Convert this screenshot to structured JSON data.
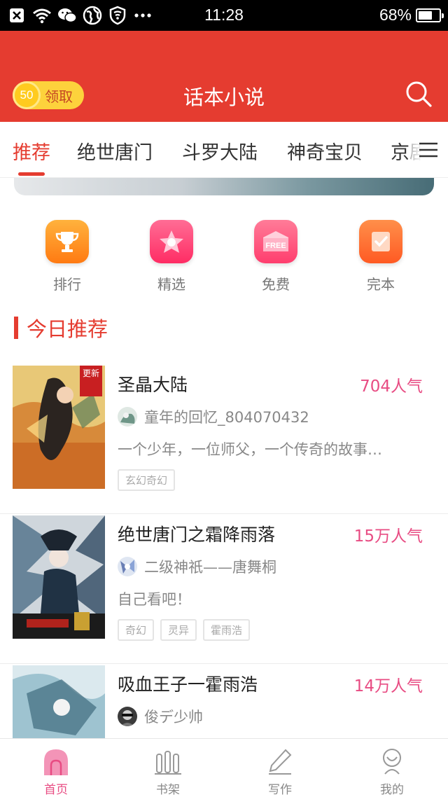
{
  "status_bar": {
    "time": "11:28",
    "battery": "68%",
    "battery_level": 0.68,
    "icons": [
      "close-box-icon",
      "wifi-icon",
      "wechat-icon",
      "globe-icon",
      "shield-icon",
      "more-dots-icon"
    ]
  },
  "header": {
    "coin_amount": "50",
    "claim_label": "领取",
    "title": "话本小说",
    "search_icon": "search-icon"
  },
  "tabs": [
    {
      "label": "推荐",
      "active": true
    },
    {
      "label": "绝世唐门",
      "active": false
    },
    {
      "label": "斗罗大陆",
      "active": false
    },
    {
      "label": "神奇宝贝",
      "active": false
    },
    {
      "label": "京剧",
      "active": false
    }
  ],
  "quick_entries": [
    {
      "label": "排行",
      "icon": "trophy-icon",
      "color": "#ff8a1d"
    },
    {
      "label": "精选",
      "icon": "star-icon",
      "color": "#ff3f77"
    },
    {
      "label": "免费",
      "icon": "free-icon",
      "color": "#ff4f76",
      "icon_text": "FREE"
    },
    {
      "label": "完本",
      "icon": "check-note-icon",
      "color": "#ff6633"
    }
  ],
  "section": {
    "title": "今日推荐"
  },
  "books": [
    {
      "title": "圣晶大陆",
      "popularity": "704人气",
      "author": "童年的回忆_804070432",
      "description": "一个少年，一位师父，一个传奇的故事…",
      "tags": [
        "玄幻奇幻"
      ],
      "badge": "更新"
    },
    {
      "title": "绝世唐门之霜降雨落",
      "popularity": "15万人气",
      "author": "二级神祇——唐舞桐",
      "description": "自己看吧！",
      "tags": [
        "奇幻",
        "灵异",
        "霍雨浩"
      ]
    },
    {
      "title": "吸血王子一霍雨浩",
      "popularity": "14万人气",
      "author": "俊デ少帅",
      "description": "",
      "tags": []
    }
  ],
  "bottom_nav": [
    {
      "label": "首页",
      "icon": "home-icon",
      "active": true
    },
    {
      "label": "书架",
      "icon": "bookshelf-icon",
      "active": false
    },
    {
      "label": "写作",
      "icon": "pen-icon",
      "active": false
    },
    {
      "label": "我的",
      "icon": "profile-icon",
      "active": false
    }
  ],
  "colors": {
    "brand_red": "#e53c30",
    "pink": "#e84c83",
    "coin_yellow": "#fdd23c"
  }
}
